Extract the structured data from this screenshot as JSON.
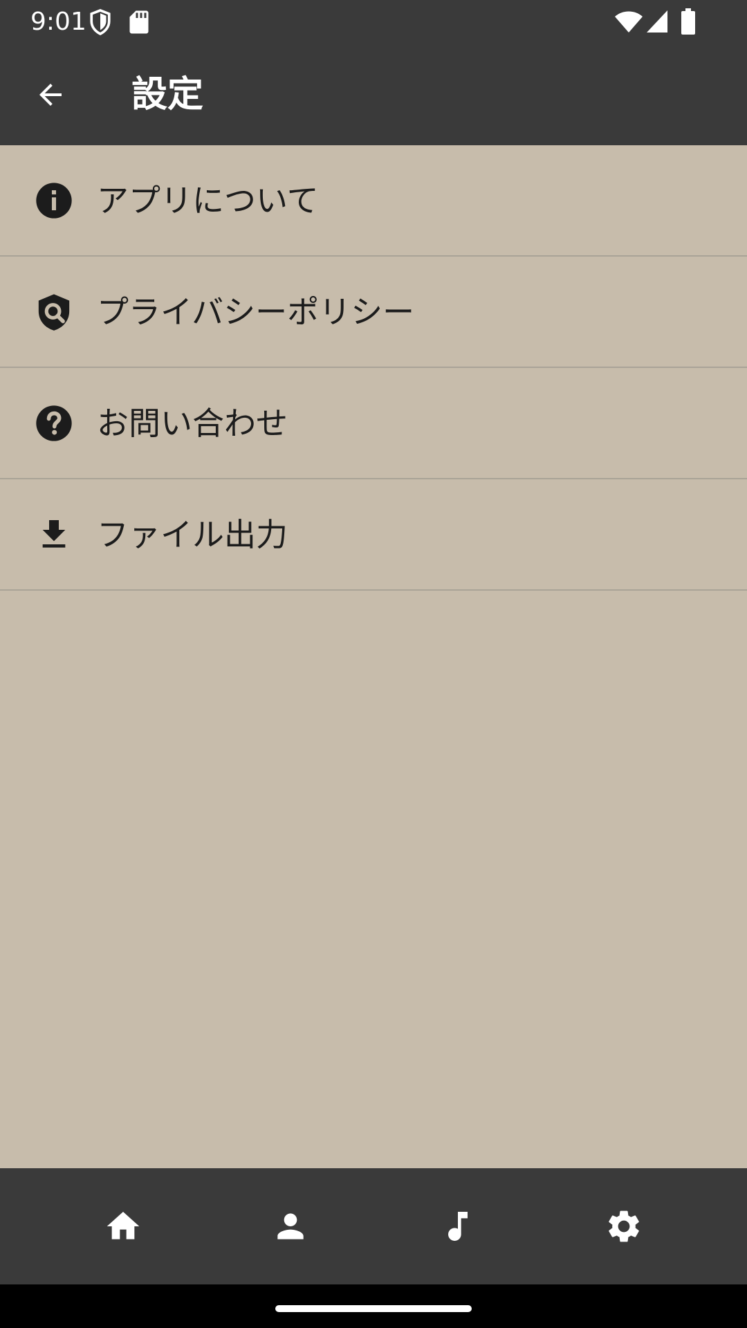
{
  "status_bar": {
    "time": "9:01",
    "icons": [
      "vpn-shield-icon",
      "sd-card-icon",
      "wifi-icon",
      "cell-signal-icon",
      "battery-icon"
    ]
  },
  "app_bar": {
    "back_icon": "arrow-back-icon",
    "title": "設定"
  },
  "settings": {
    "items": [
      {
        "label": "アプリについて",
        "icon": "info-icon"
      },
      {
        "label": "プライバシーポリシー",
        "icon": "privacy-shield-icon"
      },
      {
        "label": "お問い合わせ",
        "icon": "help-icon"
      },
      {
        "label": "ファイル出力",
        "icon": "download-icon"
      }
    ]
  },
  "bottom_nav": {
    "items": [
      {
        "icon": "home-icon"
      },
      {
        "icon": "person-icon"
      },
      {
        "icon": "music-note-icon"
      },
      {
        "icon": "gear-icon"
      }
    ]
  },
  "colors": {
    "bar_background": "#3a3a3a",
    "content_background": "#c7bcab",
    "divider": "#a9a397",
    "icon_dark": "#1c1c1c",
    "icon_light": "#ffffff"
  }
}
